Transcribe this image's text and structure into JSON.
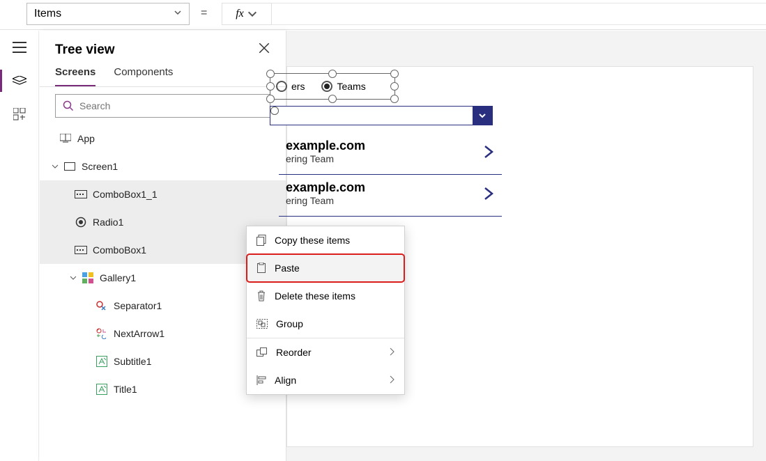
{
  "formulaBar": {
    "property": "Items",
    "equals": "=",
    "fxLabel": "fx"
  },
  "treeview": {
    "title": "Tree view",
    "tabs": {
      "screens": "Screens",
      "components": "Components"
    },
    "searchPlaceholder": "Search",
    "nodes": {
      "app": "App",
      "screen1": "Screen1",
      "combobox1_1": "ComboBox1_1",
      "radio1": "Radio1",
      "combobox1": "ComboBox1",
      "gallery1": "Gallery1",
      "separator1": "Separator1",
      "nextarrow1": "NextArrow1",
      "subtitle1": "Subtitle1",
      "title1": "Title1"
    }
  },
  "canvas": {
    "radio": {
      "opt1": "ers",
      "opt2": "Teams"
    },
    "rows": [
      {
        "title": "example.com",
        "subtitle": "ering Team"
      },
      {
        "title": "example.com",
        "subtitle": "ering Team"
      }
    ]
  },
  "contextMenu": {
    "copy": "Copy these items",
    "paste": "Paste",
    "delete": "Delete these items",
    "group": "Group",
    "reorder": "Reorder",
    "align": "Align"
  }
}
